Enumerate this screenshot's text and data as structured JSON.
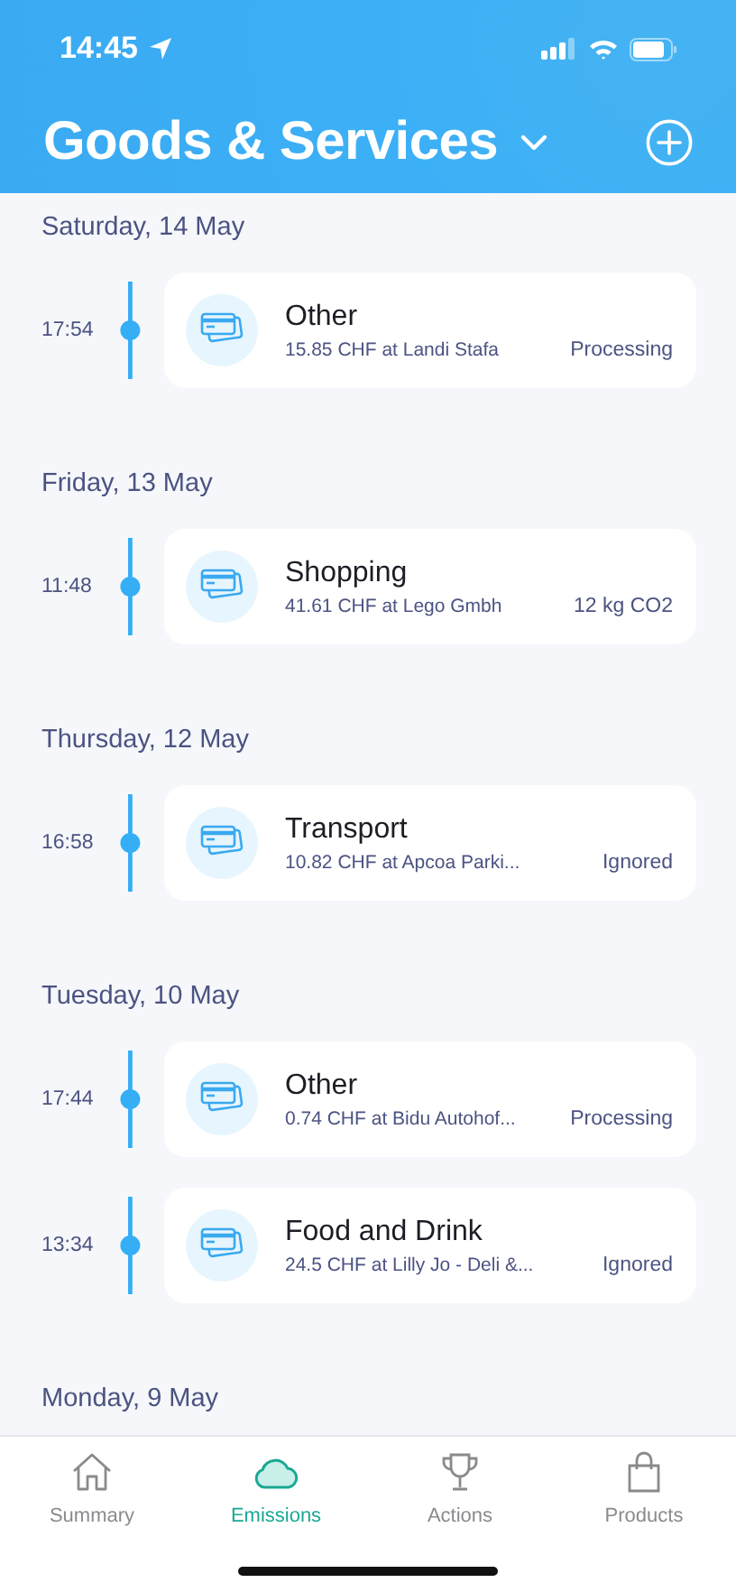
{
  "status_bar": {
    "time": "14:45"
  },
  "header": {
    "title": "Goods & Services"
  },
  "days": [
    {
      "date": "Saturday, 14 May",
      "entries": [
        {
          "time": "17:54",
          "category": "Other",
          "detail": "15.85 CHF at Landi Stafa",
          "status": "Processing"
        }
      ]
    },
    {
      "date": "Friday, 13 May",
      "entries": [
        {
          "time": "11:48",
          "category": "Shopping",
          "detail": "41.61 CHF at Lego Gmbh",
          "status": "12 kg CO2"
        }
      ]
    },
    {
      "date": "Thursday, 12 May",
      "entries": [
        {
          "time": "16:58",
          "category": "Transport",
          "detail": "10.82 CHF at Apcoa Parki...",
          "status": "Ignored"
        }
      ]
    },
    {
      "date": "Tuesday, 10 May",
      "entries": [
        {
          "time": "17:44",
          "category": "Other",
          "detail": "0.74 CHF at Bidu Autohof...",
          "status": "Processing"
        },
        {
          "time": "13:34",
          "category": "Food and Drink",
          "detail": "24.5 CHF at Lilly Jo - Deli &...",
          "status": "Ignored"
        }
      ]
    },
    {
      "date": "Monday, 9 May"
    }
  ],
  "tab_bar": [
    {
      "label": "Summary",
      "kind": "home",
      "selected": false
    },
    {
      "label": "Emissions",
      "kind": "cloud",
      "selected": true
    },
    {
      "label": "Actions",
      "kind": "trophy",
      "selected": false
    },
    {
      "label": "Products",
      "kind": "bag",
      "selected": false
    }
  ]
}
